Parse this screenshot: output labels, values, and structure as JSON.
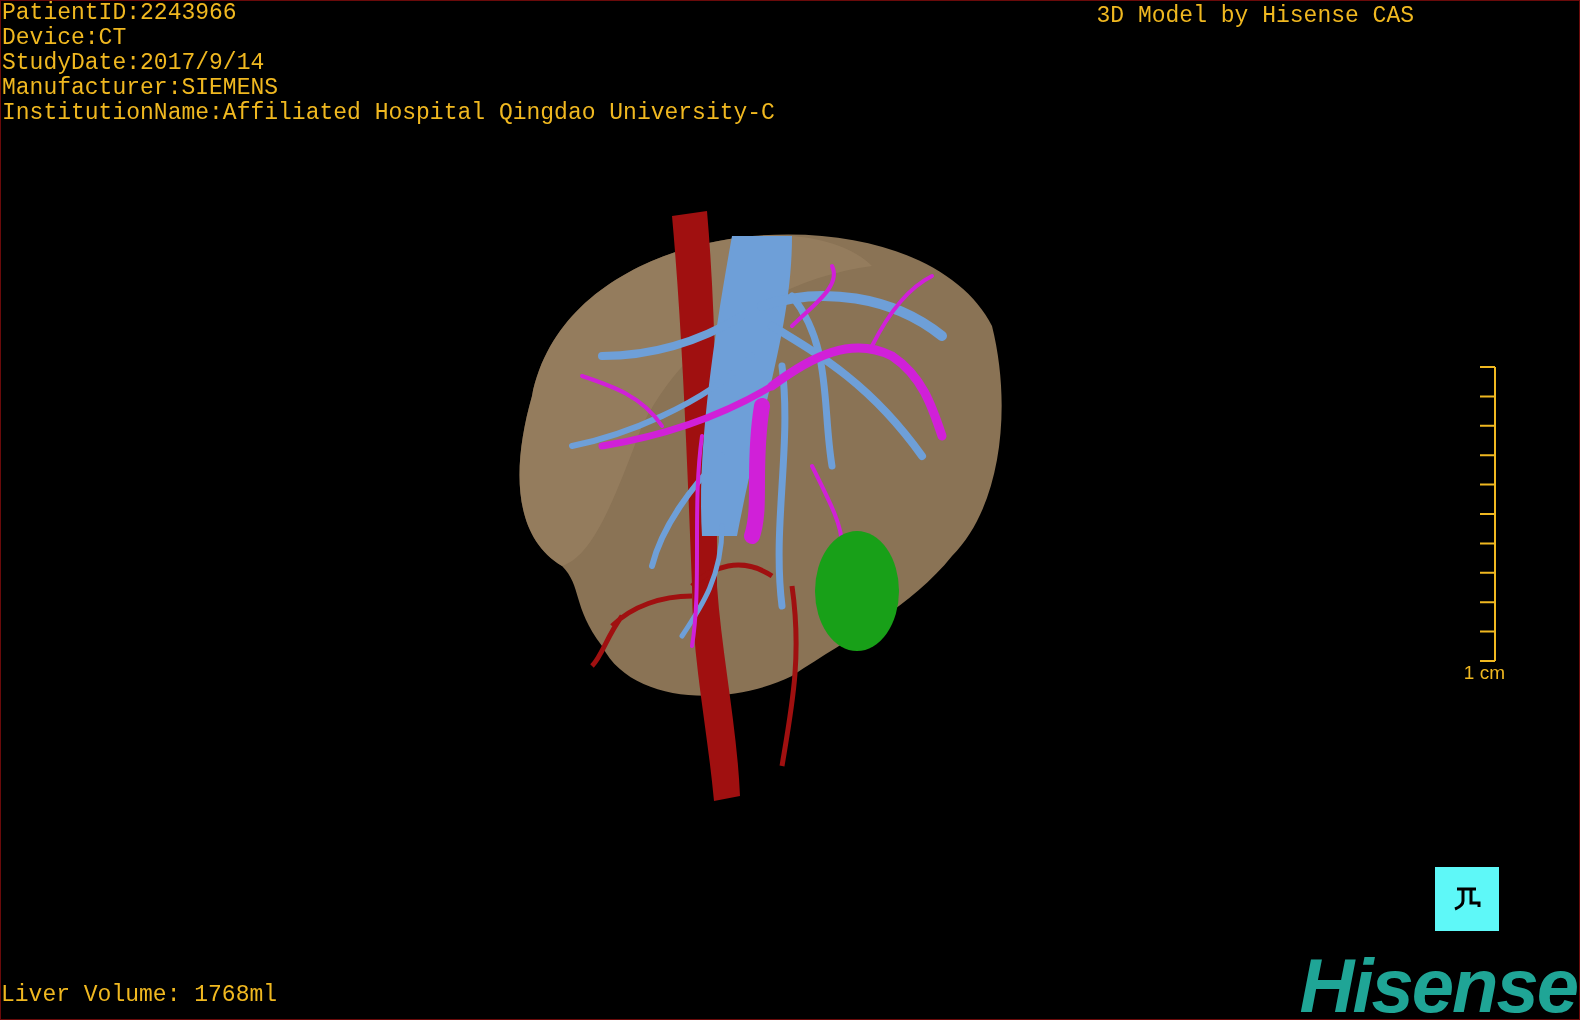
{
  "overlay": {
    "info_lines": [
      "PatientID:2243966",
      "Device:CT",
      "StudyDate:2017/9/14",
      "Manufacturer:SIEMENS",
      "InstitutionName:Affiliated Hospital Qingdao University-C"
    ],
    "title": "3D Model by Hisense CAS"
  },
  "scale_bar": {
    "label": "1 cm"
  },
  "liver_volume": "Liver Volume: 1768ml",
  "logo": "Hisense"
}
